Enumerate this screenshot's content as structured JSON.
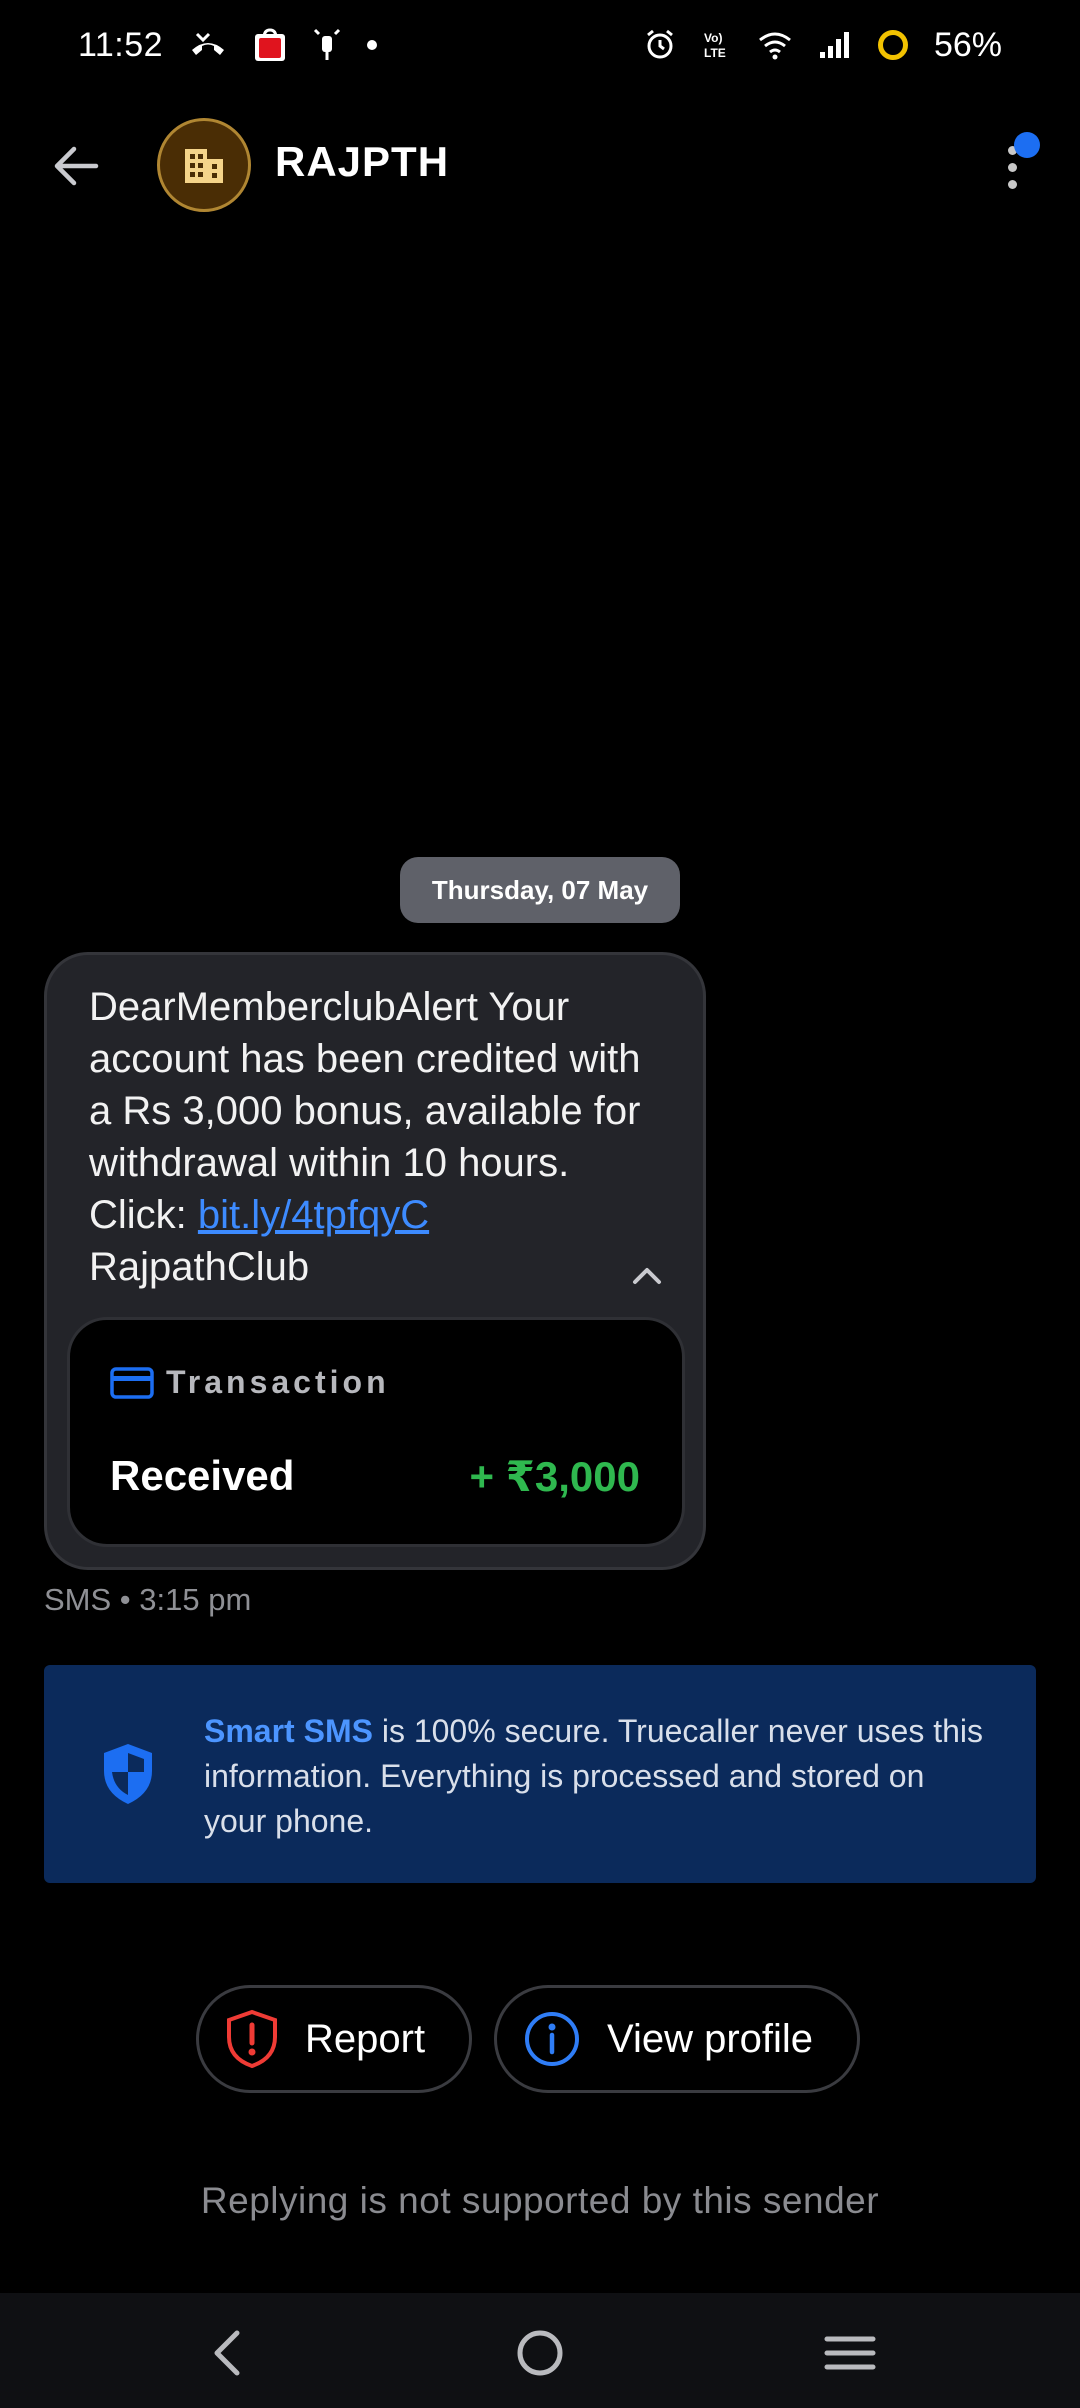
{
  "status_bar": {
    "time": "11:52",
    "battery": "56%",
    "icons": [
      "missed-call-icon",
      "shopping-bag-icon",
      "notification-icon",
      "dot-icon",
      "alarm-icon",
      "volte-icon",
      "wifi-icon",
      "signal-icon",
      "battery-saver-icon"
    ]
  },
  "header": {
    "title": "RAJPTH",
    "avatar_icon": "building-icon",
    "back_icon": "back-arrow-icon",
    "menu_icon": "more-vert-icon",
    "accent_color": "#1c6ef2"
  },
  "conversation": {
    "date_chip": "Thursday, 07 May",
    "message": {
      "text_before_link": "DearMemberclubAlert Your account has been credited with a Rs 3,000 bonus, available for withdrawal within 10 hours. Click: ",
      "link": "bit.ly/4tpfqyC",
      "text_after_link": " RajpathClub",
      "meta": "SMS • 3:15 pm"
    },
    "transaction": {
      "label": "Transaction",
      "type": "Received",
      "amount": "+ ₹3,000",
      "amount_color": "#2fb84f"
    }
  },
  "smart_sms": {
    "highlight": "Smart SMS",
    "text": " is 100% secure. Truecaller never uses this information. Everything is processed and stored on your phone."
  },
  "actions": {
    "report_label": "Report",
    "view_profile_label": "View profile"
  },
  "footer": {
    "reply_note": "Replying is not supported by this sender"
  },
  "nav": {
    "icons": [
      "nav-back-icon",
      "nav-home-icon",
      "nav-recents-icon"
    ]
  }
}
